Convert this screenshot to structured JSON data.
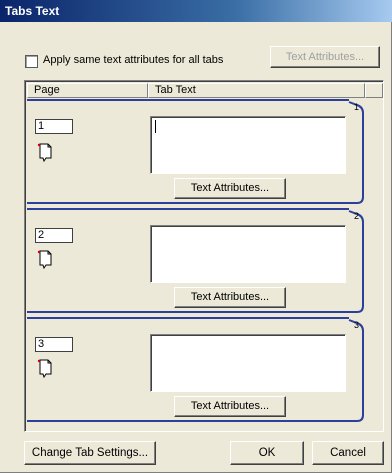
{
  "window": {
    "title": "Tabs Text"
  },
  "options": {
    "apply_same_label": "Apply same text attributes for all tabs",
    "apply_same_checked": false,
    "text_attributes_label": "Text Attributes..."
  },
  "columns": {
    "page": "Page",
    "tab_text": "Tab Text"
  },
  "tabs": [
    {
      "number": "1",
      "page": "1",
      "text": "",
      "attributes_button": "Text Attributes..."
    },
    {
      "number": "2",
      "page": "2",
      "text": "",
      "attributes_button": "Text Attributes..."
    },
    {
      "number": "3",
      "page": "3",
      "text": "",
      "attributes_button": "Text Attributes..."
    }
  ],
  "footer": {
    "change_tab_settings": "Change Tab Settings...",
    "ok": "OK",
    "cancel": "Cancel"
  },
  "colors": {
    "tab_outline": "#2b3f9b",
    "titlebar": "#0a246a"
  },
  "icons": {
    "page_icon": "document-page-icon"
  }
}
